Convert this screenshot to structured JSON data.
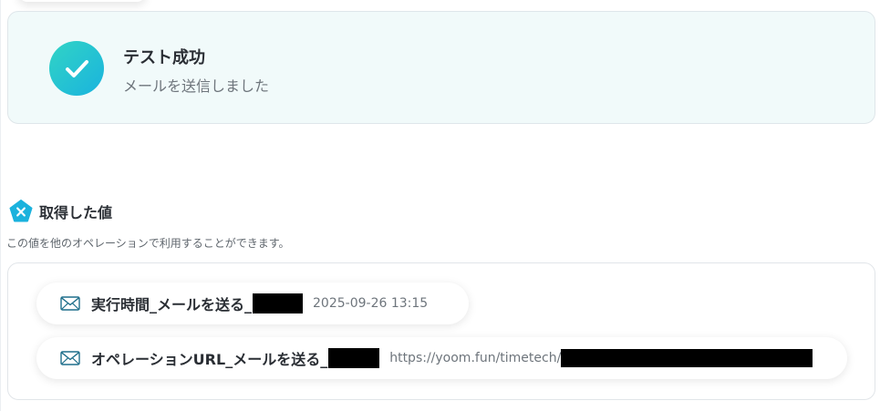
{
  "success": {
    "title": "テスト成功",
    "subtitle": "メールを送信しました",
    "icon": "check-icon"
  },
  "values_section": {
    "title": "取得した値",
    "description": "この値を他のオペレーションで利用することができます。",
    "icon": "variable-x-icon",
    "items": [
      {
        "label": "実行時間_メールを送る_",
        "value": "2025-09-26 13:15",
        "icon": "mail-icon"
      },
      {
        "label": "オペレーションURL_メールを送る_",
        "value": "https://yoom.fun/timetech/",
        "icon": "mail-icon"
      }
    ]
  },
  "colors": {
    "success_bg": "#f1fafa",
    "check_gradient_start": "#31d4c5",
    "check_gradient_end": "#1ab3de",
    "variable_icon": "#1bb2dd",
    "mail_icon_stroke": "#1f6f8b"
  }
}
